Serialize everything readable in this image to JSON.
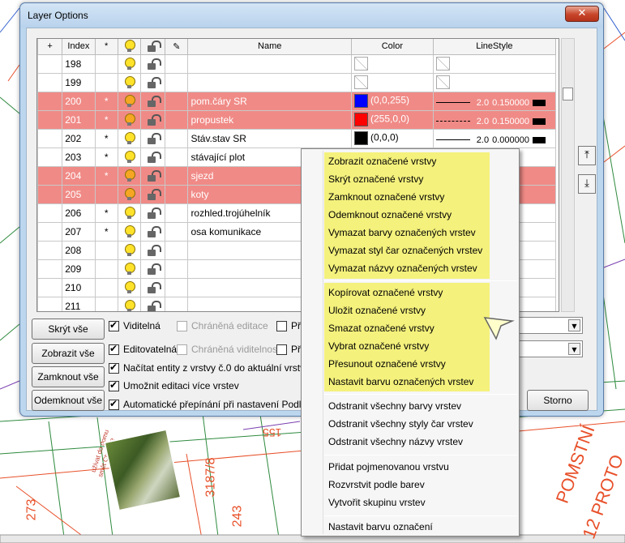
{
  "window": {
    "title": "Layer Options",
    "close_glyph": "✕"
  },
  "table": {
    "headers": [
      "+",
      "Index",
      "*",
      "",
      "",
      "",
      "Name",
      "Color",
      "LineStyle"
    ],
    "rows": [
      {
        "index": "198",
        "star": "",
        "name": "",
        "color_label": "",
        "color_hex": "",
        "ls_width": "",
        "ls_weight": "",
        "selected": false
      },
      {
        "index": "199",
        "star": "",
        "name": "",
        "color_label": "",
        "color_hex": "",
        "ls_width": "",
        "ls_weight": "",
        "selected": false
      },
      {
        "index": "200",
        "star": "*",
        "name": "pom.čáry SR",
        "color_label": "(0,0,255)",
        "color_hex": "#0000ff",
        "ls_width": "2.0",
        "ls_weight": "0.150000",
        "selected": true
      },
      {
        "index": "201",
        "star": "*",
        "name": "propustek",
        "color_label": "(255,0,0)",
        "color_hex": "#ff0000",
        "ls_width": "2.0",
        "ls_weight": "0.150000",
        "selected": true
      },
      {
        "index": "202",
        "star": "*",
        "name": "Stáv.stav SR",
        "color_label": "(0,0,0)",
        "color_hex": "#000000",
        "ls_width": "2.0",
        "ls_weight": "0.000000",
        "selected": false
      },
      {
        "index": "203",
        "star": "*",
        "name": "stávající plot",
        "color_label": "",
        "color_hex": "#000000",
        "ls_width": "",
        "ls_weight": "",
        "selected": false
      },
      {
        "index": "204",
        "star": "*",
        "name": "sjezd",
        "color_label": "",
        "color_hex": "",
        "ls_width": "",
        "ls_weight": "",
        "selected": true
      },
      {
        "index": "205",
        "star": "",
        "name": "koty",
        "color_label": "",
        "color_hex": "",
        "ls_width": "",
        "ls_weight": "",
        "selected": true
      },
      {
        "index": "206",
        "star": "*",
        "name": "rozhled.trojúhelník",
        "color_label": "",
        "color_hex": "",
        "ls_width": "",
        "ls_weight": "",
        "selected": false
      },
      {
        "index": "207",
        "star": "*",
        "name": "osa komunikace",
        "color_label": "",
        "color_hex": "",
        "ls_width": "",
        "ls_weight": "",
        "selected": false
      },
      {
        "index": "208",
        "star": "",
        "name": "",
        "color_label": "",
        "color_hex": "",
        "ls_width": "",
        "ls_weight": "",
        "selected": false
      },
      {
        "index": "209",
        "star": "",
        "name": "",
        "color_label": "",
        "color_hex": "",
        "ls_width": "",
        "ls_weight": "",
        "selected": false
      },
      {
        "index": "210",
        "star": "",
        "name": "",
        "color_label": "",
        "color_hex": "",
        "ls_width": "",
        "ls_weight": "",
        "selected": false
      },
      {
        "index": "211",
        "star": "",
        "name": "",
        "color_label": "",
        "color_hex": "",
        "ls_width": "",
        "ls_weight": "",
        "selected": false
      }
    ]
  },
  "buttons": {
    "hide_all": "Skrýt vše",
    "show_all": "Zobrazit vše",
    "lock_all": "Zamknout vše",
    "unlock_all": "Odemknout vše",
    "cancel": "Storno"
  },
  "checkboxes": {
    "visible": "Viditelná",
    "protected_edit": "Chráněná editace",
    "pri_1": "Při",
    "editable": "Editovatelná",
    "protected_visibility": "Chráněná viditelnost",
    "pri_2": "Při",
    "load_entities": "Načítat entity z vrstvy č.0 do aktuální vrstvy",
    "multi_edit": "Umožnit editaci více vrstev",
    "auto_switch": "Automatické přepínání při nastavení Podle vrst"
  },
  "context_menu": {
    "group1": [
      "Zobrazit označené vrstvy",
      "Skrýt označené vrstvy",
      "Zamknout označené vrstvy",
      "Odemknout označené vrstvy",
      "Vymazat barvy označených vrstev",
      "Vymazat styl čar označených vrstev",
      "Vymazat názvy označených vrstev"
    ],
    "group2": [
      "Kopírovat označené vrstvy",
      "Uložit označené vrstvy",
      "Smazat označené vrstvy",
      "Vybrat označené vrstvy",
      "Přesunout označené vrstvy",
      "Nastavit barvu označených vrstev"
    ],
    "group3": [
      "Odstranit všechny barvy vrstev",
      "Odstranit všechny styly čar vrstev",
      "Odstranit všechny názvy vrstev"
    ],
    "group4": [
      "Přidat pojmenovanou vrstvu",
      "Rozvrstvit podle barev",
      "Vytvořit skupinu vrstev"
    ],
    "group5": [
      "Nastavit barvu označení"
    ]
  },
  "cad": {
    "labels": [
      "273",
      "243",
      "3187/8",
      "155",
      "POMSTNÍ",
      "12 PROTO",
      "užívat do domu",
      "smět Chráníte"
    ]
  },
  "colors": {
    "selected_row": "#f08a86",
    "menu_highlight": "#f4f17c",
    "cad_orange": "#e8502a",
    "cad_green": "#2e8a3e"
  }
}
